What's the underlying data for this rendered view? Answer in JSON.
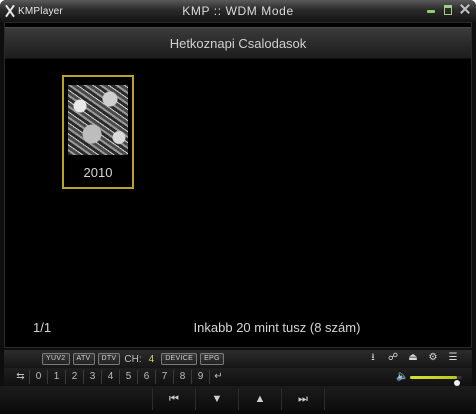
{
  "app": {
    "logo_text": "KMPlayer",
    "title": "KMP :: WDM Mode"
  },
  "window_buttons": [
    "minimize-icon",
    "maximize-icon",
    "close-icon"
  ],
  "screen": {
    "header": "Hetkoznapi Csalodasok",
    "album": {
      "year": "2010"
    },
    "page_indicator": "1/1",
    "album_info": "Inkabb 20 mint tusz (8 szám)"
  },
  "control_bar": {
    "tags": [
      "YUV2",
      "ATV",
      "DTV"
    ],
    "ch_label": "CH:",
    "ch_value": "4",
    "tags2": [
      "DEVICE",
      "EPG"
    ],
    "icons": [
      "download-icon",
      "person-icon",
      "eject-icon",
      "gear-icon",
      "playlist-icon"
    ],
    "number_keys": [
      "0",
      "1",
      "2",
      "3",
      "4",
      "5",
      "6",
      "7",
      "8",
      "9"
    ],
    "volume_level": 0.9
  },
  "transport": [
    "previous-icon",
    "down-icon",
    "up-icon",
    "next-icon"
  ],
  "colors": {
    "highlight": "#b8a227",
    "channel": "#d9d070",
    "volume": "#d8e030"
  }
}
